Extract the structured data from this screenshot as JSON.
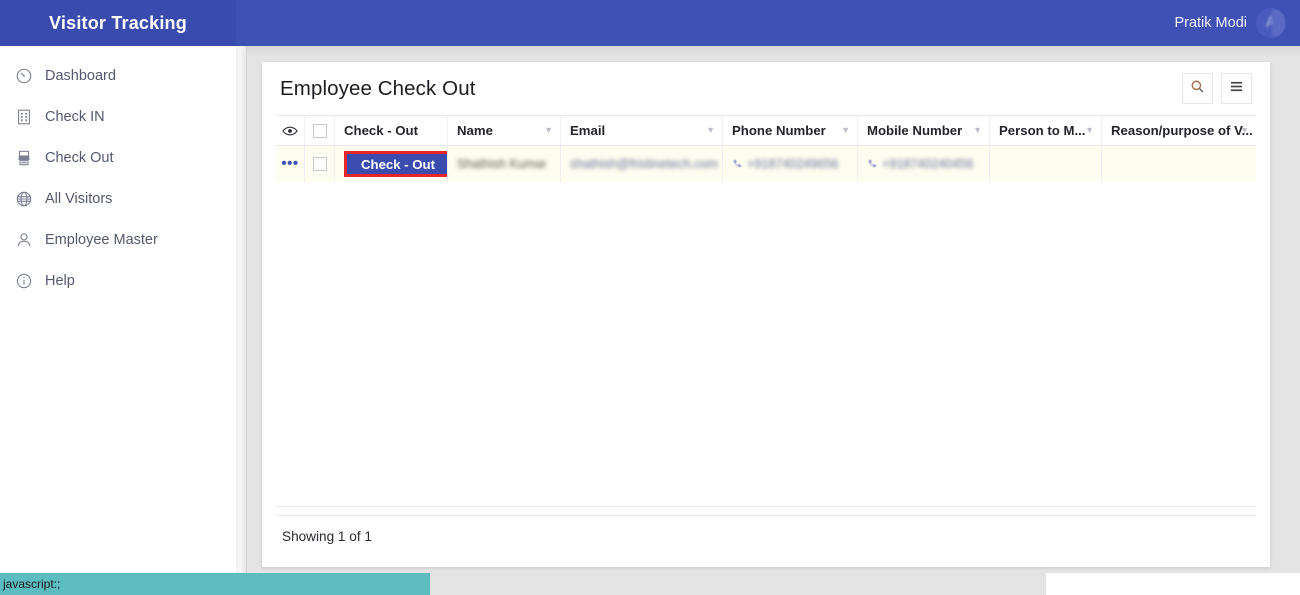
{
  "topbar": {
    "brand": "Visitor Tracking",
    "user_name": "Pratik Modi",
    "avatar_glyph": "A",
    "brand_bg": "#3a4bae",
    "bar_bg": "#3f51b5"
  },
  "sidebar": {
    "items": [
      {
        "label": "Dashboard",
        "icon": "gauge-icon"
      },
      {
        "label": "Check IN",
        "icon": "form-grid-icon"
      },
      {
        "label": "Check Out",
        "icon": "device-icon"
      },
      {
        "label": "All Visitors",
        "icon": "globe-icon"
      },
      {
        "label": "Employee Master",
        "icon": "person-icon"
      },
      {
        "label": "Help",
        "icon": "info-circle-icon"
      }
    ]
  },
  "card": {
    "title": "Employee Check Out",
    "actions": [
      {
        "name": "search",
        "icon": "search-icon"
      },
      {
        "name": "menu",
        "icon": "hamburger-icon"
      }
    ]
  },
  "table": {
    "columns": [
      {
        "key": "eye",
        "label": "",
        "sortable": false
      },
      {
        "key": "check",
        "label": "",
        "sortable": false
      },
      {
        "key": "action",
        "label": "Check - Out",
        "sortable": false
      },
      {
        "key": "name",
        "label": "Name",
        "sortable": true
      },
      {
        "key": "email",
        "label": "Email",
        "sortable": true
      },
      {
        "key": "phone",
        "label": "Phone Number",
        "sortable": true
      },
      {
        "key": "mobile",
        "label": "Mobile Number",
        "sortable": true
      },
      {
        "key": "person",
        "label": "Person to M...",
        "sortable": true
      },
      {
        "key": "reason",
        "label": "Reason/purpose of V...",
        "sortable": true
      }
    ],
    "rows": [
      {
        "action_label": "Check - Out",
        "action_highlighted": true,
        "name": "Shathish Kumar",
        "email": "shathish@fristinetech.com",
        "phone": "+918740249656",
        "mobile": "+918740240456",
        "person": "",
        "reason": "",
        "redacted": true
      }
    ],
    "footer_text": "Showing 1 of 1"
  },
  "fab": {
    "label": "+",
    "name": "add-button",
    "color": "#3b4cae"
  },
  "statusbar": {
    "text": "javascript:;",
    "bg": "#5cbcc0"
  },
  "colors": {
    "primary": "#3f51b5",
    "highlight_border": "#e8262a",
    "row_bg": "#fdfdf0",
    "page_bg": "#e4e4e4"
  }
}
